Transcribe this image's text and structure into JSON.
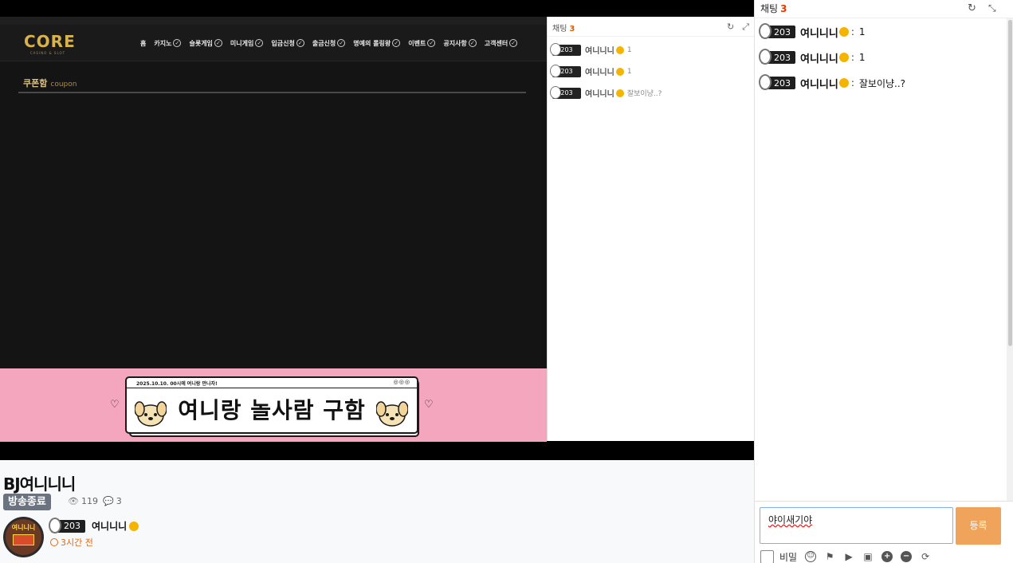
{
  "stream": {
    "site_coupon_title": "쿠폰함",
    "site_coupon_sub": "coupon",
    "site_logo": "CORE",
    "site_logo_sub": "CASINO & SLOT",
    "nav_items": [
      "홈",
      "카지노",
      "슬롯게임",
      "미니게임",
      "입금신청",
      "출금신청",
      "명예의 롤링왕",
      "이벤트",
      "공지사항",
      "고객센터"
    ],
    "banner_date": "2025.10.10. 00시에 여니랑 만나자!",
    "banner_title": "여니랑 놀사람 구함",
    "heart": "♡",
    "banner_dots": "◎◎◎"
  },
  "overlay_chat": {
    "title": "채팅",
    "count": "3",
    "messages": [
      {
        "badge": "203",
        "name": "여니니니",
        "text": "1"
      },
      {
        "badge": "203",
        "name": "여니니니",
        "text": "1"
      },
      {
        "badge": "203",
        "name": "여니니니",
        "text": "잘보이냥..?"
      }
    ]
  },
  "info": {
    "bj_title": "BJ여니니니",
    "status": "방송종료",
    "views": "119",
    "comments": "3",
    "author_badge": "203",
    "author_name": "여니니니",
    "time_ago": "3시간 전",
    "avatar_label": "여니니니"
  },
  "chat": {
    "title": "채팅",
    "count": "3",
    "separator": ":",
    "messages": [
      {
        "badge": "203",
        "name": "여니니니",
        "text": "1"
      },
      {
        "badge": "203",
        "name": "여니니니",
        "text": "1"
      },
      {
        "badge": "203",
        "name": "여니니니",
        "text": "잘보이냥..?"
      }
    ],
    "input_value": "야이새기야",
    "send_label": "등록",
    "secret_label": "비밀"
  },
  "icons": {
    "refresh": "refresh-icon",
    "collapse": "collapse-icon",
    "eye": "eye-icon",
    "comment": "comment-icon",
    "clock": "clock-icon",
    "emoji": "emoji-icon",
    "flag": "flag-icon",
    "youtube": "youtube-icon",
    "image": "image-icon",
    "zoom_in": "zoom-in-icon",
    "zoom_out": "zoom-out-icon",
    "reload": "reload-icon"
  },
  "colors": {
    "accent_orange": "#f0a35a",
    "count_red": "#e03b00",
    "banner_pink": "#f4a6be",
    "verify_gold": "#f5b400",
    "status_gray": "#6b7380"
  }
}
